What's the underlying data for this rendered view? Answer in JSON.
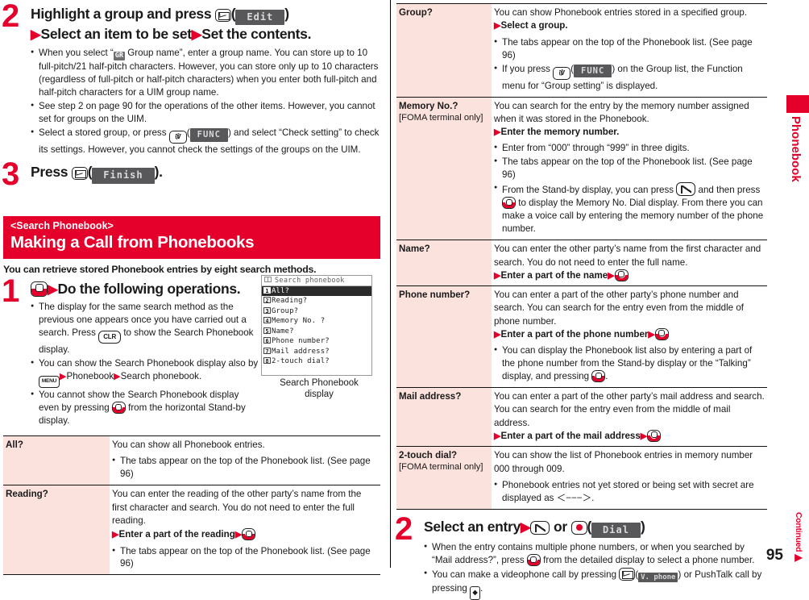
{
  "page": {
    "number": "95",
    "continued_label": "Continued",
    "side_tab_label": "Phonebook"
  },
  "left": {
    "step2": {
      "num": "2",
      "line1_a": "Highlight a group and press",
      "line1_softkey": "Edit",
      "line2_a": "Select an item to be set",
      "line2_b": "Set the contents.",
      "bullets": [
        {
          "pre": "When you select “",
          "badge": "GR",
          "post": " Group name”, enter a group name. You can store up to 10 full-pitch/21 half-pitch characters. However, you can store only up to 10 characters (regardless of full-pitch or half-pitch characters) when you enter both full-pitch and half-pitch characters for a UIM group name."
        },
        {
          "text": "See step 2 on page 90 for the operations of the other items. However, you cannot set for groups on the UIM."
        },
        {
          "pre": "Select a stored group, or press ",
          "softkey": "FUNC",
          "post": " and select “Check setting” to check its settings. However, you cannot check the settings of the groups on the UIM."
        }
      ]
    },
    "step3": {
      "num": "3",
      "text": "Press",
      "softkey": "Finish",
      "tail": ")."
    },
    "section": {
      "subtitle": "<Search Phonebook>",
      "title": "Making a Call from Phonebooks",
      "intro": "You can retrieve stored Phonebook entries by eight search methods."
    },
    "step1": {
      "num": "1",
      "head": "Do the following operations.",
      "bullets": [
        {
          "pre": "The display for the same search method as the previous one appears once you have carried out a search. Press ",
          "key": "CLR",
          "post": " to show the Search Phonebook display."
        },
        {
          "pre": "You can show the Search Phonebook display also by ",
          "key": "MENU",
          "mid": "Phonebook",
          "post": "Search phonebook."
        },
        {
          "pre": "You cannot show the Search Phonebook display even by pressing ",
          "post": " from the horizontal Stand-by display."
        }
      ]
    },
    "capture": {
      "title": "Search phonebook",
      "items": [
        {
          "n": "1",
          "label": "All?",
          "selected": true
        },
        {
          "n": "2",
          "label": "Reading?",
          "selected": false
        },
        {
          "n": "3",
          "label": "Group?",
          "selected": false
        },
        {
          "n": "4",
          "label": "Memory No. ?",
          "selected": false
        },
        {
          "n": "5",
          "label": "Name?",
          "selected": false
        },
        {
          "n": "6",
          "label": "Phone number?",
          "selected": false
        },
        {
          "n": "7",
          "label": "Mail address?",
          "selected": false
        },
        {
          "n": "8",
          "label": "2-touch dial?",
          "selected": false
        }
      ],
      "caption_line1": "Search Phonebook",
      "caption_line2": "display"
    },
    "table": [
      {
        "key": "All?",
        "sub": "",
        "lines": [
          "You can show all Phonebook entries."
        ],
        "bullets": [
          "The tabs appear on the top of the Phonebook list. (See page 96)"
        ],
        "action": ""
      },
      {
        "key": "Reading?",
        "sub": "",
        "lines": [
          "You can enter the reading of the other party’s name from the first character and search. You do not need to enter the full reading."
        ],
        "action": "Enter a part of the reading",
        "bullets": [
          "The tabs appear on the top of the Phonebook list. (See page 96)"
        ]
      }
    ]
  },
  "right": {
    "table": [
      {
        "key": "Group?",
        "sub": "",
        "lines": [
          "You can show Phonebook entries stored in a specified group."
        ],
        "action": "Select a group.",
        "action_no_key": true,
        "bullets": [
          {
            "text": "The tabs appear on the top of the Phonebook list. (See page 96)"
          },
          {
            "pre": "If you press ",
            "softkey": "FUNC",
            "post": " on the Group list, the Function menu for “Group setting” is displayed."
          }
        ]
      },
      {
        "key": "Memory No.?",
        "sub": "[FOMA terminal only]",
        "lines": [
          "You can search for the entry by the memory number assigned when it was stored in the Phonebook."
        ],
        "action": "Enter the memory number.",
        "action_no_key": true,
        "bullets": [
          {
            "text": "Enter from “000” through “999” in three digits."
          },
          {
            "text": "The tabs appear on the top of the Phonebook list. (See page 96)"
          },
          {
            "pre": "From the Stand-by display, you can press ",
            "key": "call",
            "mid": " and then press ",
            "key2": "nav",
            "post": " to display the Memory No. Dial display. From there you can make a voice call by entering the memory number of the phone number."
          }
        ]
      },
      {
        "key": "Name?",
        "sub": "",
        "lines": [
          "You can enter the other party’s name from the first character and search. You do not need to enter the full name."
        ],
        "action": "Enter a part of the name",
        "bullets": []
      },
      {
        "key": "Phone number?",
        "sub": "",
        "lines": [
          "You can enter a part of the other party’s phone number and search. You can search for the entry even from the middle of phone number."
        ],
        "action": "Enter a part of the phone number",
        "bullets": [
          {
            "pre": "You can display the Phonebook list also by entering a part of the phone number from the Stand-by display or the “Talking” display, and pressing ",
            "key2": "nav",
            "post": "."
          }
        ]
      },
      {
        "key": "Mail address?",
        "sub": "",
        "lines": [
          "You can enter a part of the other party’s mail address and search. You can search for the entry even from the middle of mail address."
        ],
        "action": "Enter a part of the mail address",
        "bullets": []
      },
      {
        "key": "2-touch dial?",
        "sub": "[FOMA terminal only]",
        "lines": [
          "You can show the list of Phonebook entries in memory number 000 through 009."
        ],
        "action": "",
        "bullets": [
          {
            "text": "Phonebook entries not yet stored or being set with secret are displayed as ＜−−−＞."
          }
        ]
      }
    ],
    "step2": {
      "num": "2",
      "head": "Select an entry",
      "or_label": "or",
      "softkey": "Dial",
      "bullets": [
        {
          "pre": "When the entry contains multiple phone numbers, or when you searched by “Mail address?”, press ",
          "post": " from the detailed display to select a phone number."
        },
        {
          "pre": "You can make a videophone call by pressing ",
          "softkey": "V. phone",
          "post": " or PushTalk call by pressing "
        }
      ]
    }
  },
  "colors": {
    "accent": "#e4002b",
    "key_cell_bg": "#fbe2dd",
    "softkey_bg": "#58585a"
  }
}
